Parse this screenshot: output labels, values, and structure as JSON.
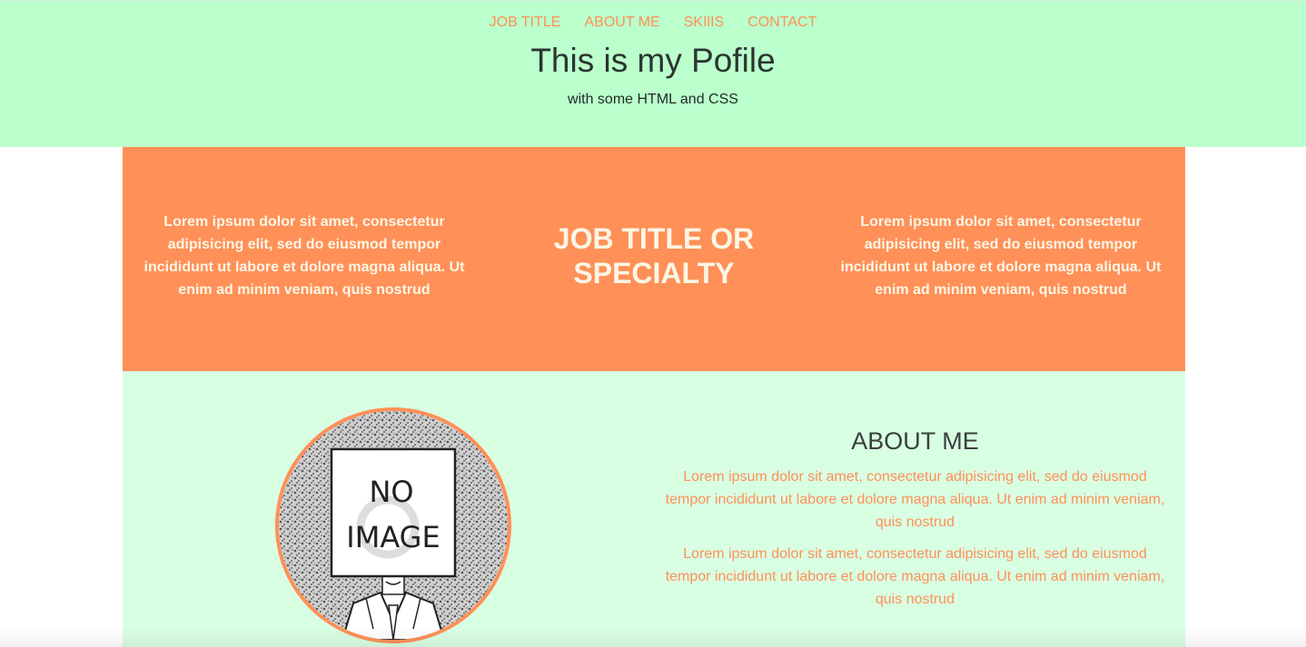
{
  "nav": {
    "items": [
      {
        "label": "JOB TITLE"
      },
      {
        "label": "ABOUT ME"
      },
      {
        "label": "SKIlIS"
      },
      {
        "label": "CONTACT"
      }
    ]
  },
  "header": {
    "title": "This is my Pofile",
    "subtitle": "with some HTML and CSS"
  },
  "banner": {
    "left_text": "Lorem ipsum dolor sit amet, consectetur adipisicing elit, sed do eiusmod tempor incididunt ut labore et dolore magna aliqua. Ut enim ad minim veniam, quis nostrud",
    "title": "JOB TITLE OR SPECIALTY",
    "right_text": "Lorem ipsum dolor sit amet, consectetur adipisicing elit, sed do eiusmod tempor incididunt ut labore et dolore magna aliqua. Ut enim ad minim veniam, quis nostrud"
  },
  "about": {
    "heading": "ABOUT ME",
    "avatar_text_line1": "NO",
    "avatar_text_line2": "IMAGE",
    "paragraphs": [
      "Lorem ipsum dolor sit amet, consectetur adipisicing elit, sed do eiusmod tempor incididunt ut labore et dolore magna aliqua. Ut enim ad minim veniam, quis nostrud",
      "Lorem ipsum dolor sit amet, consectetur adipisicing elit, sed do eiusmod tempor incididunt ut labore et dolore magna aliqua. Ut enim ad minim veniam, quis nostrud"
    ]
  },
  "colors": {
    "header_bg": "#bbffcc",
    "accent": "#ff9057",
    "about_bg": "#d9ffe3",
    "banner_text": "#fbf6e6"
  }
}
